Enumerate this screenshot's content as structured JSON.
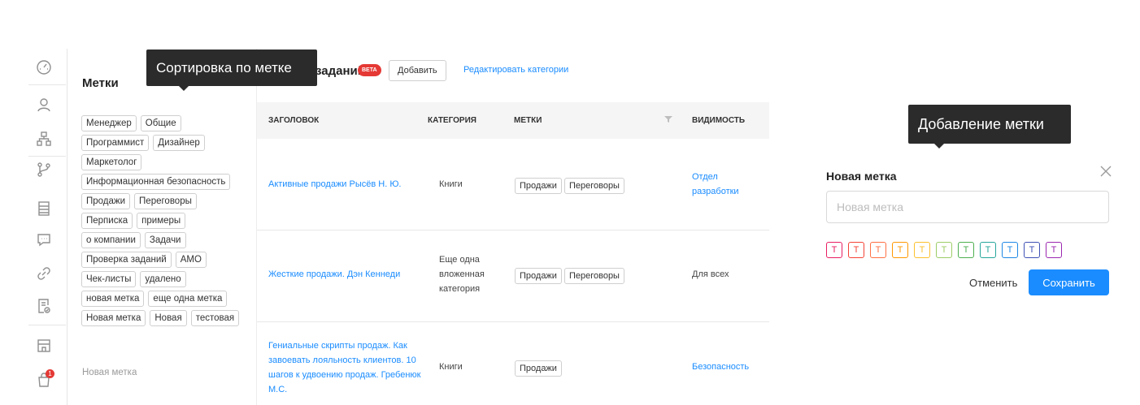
{
  "sidebar": {
    "icons": [
      "dashboard-icon",
      "user-icon",
      "org-structure-icon",
      "branch-icon",
      "document-list-icon",
      "chat-icon",
      "link-icon",
      "checklist-doc-icon",
      "store-icon",
      "shopping-bag-icon"
    ],
    "cart_badge": "1"
  },
  "tags_panel": {
    "title": "Метки",
    "tags": [
      "Менеджер",
      "Общие",
      "Программист",
      "Дизайнер",
      "Маркетолог",
      "Информационная безопасность",
      "Продажи",
      "Переговоры",
      "Перписка",
      "примеры",
      "о компании",
      "Задачи",
      "Проверка заданий",
      "AMO",
      "Чек-листы",
      "удалено",
      "новая метка",
      "еще одна метка",
      "Новая метка",
      "Новая",
      "тестовая"
    ],
    "new_tag_link": "Новая метка"
  },
  "tooltips": {
    "sort": "Сортировка по метке",
    "add": "Добавление метки"
  },
  "header": {
    "title": "заданий",
    "beta": "BETA",
    "add_button": "Добавить",
    "edit_categories": "Редактировать категории"
  },
  "table": {
    "columns": [
      "Заголовок",
      "Категория",
      "Метки",
      "Видимость"
    ],
    "rows": [
      {
        "title": "Активные продажи Рысёв Н. Ю.",
        "category": "Книги",
        "tags": [
          "Продажи",
          "Переговоры"
        ],
        "visibility": "Отдел разработки"
      },
      {
        "title": "Жесткие продажи. Дэн Кеннеди",
        "category": "Еще одна вложенная категория",
        "tags": [
          "Продажи",
          "Переговоры"
        ],
        "visibility": "Для всех"
      },
      {
        "title": "Гениальные скрипты продаж. Как завоевать лояльность клиентов. 10 шагов к удвоению продаж. Гребенюк М.С.",
        "category": "Книги",
        "tags": [
          "Продажи"
        ],
        "visibility": "Безопасность"
      }
    ]
  },
  "modal": {
    "title": "Новая метка",
    "input_placeholder": "Новая метка",
    "input_value": "",
    "swatch_label": "T",
    "swatch_colors": [
      "#e91e63",
      "#f44336",
      "#ff7043",
      "#ff9800",
      "#fbc02d",
      "#9ccc65",
      "#4caf50",
      "#26a69a",
      "#1e88e5",
      "#3f51b5",
      "#9c27b0"
    ],
    "cancel_button": "Отменить",
    "save_button": "Сохранить"
  }
}
